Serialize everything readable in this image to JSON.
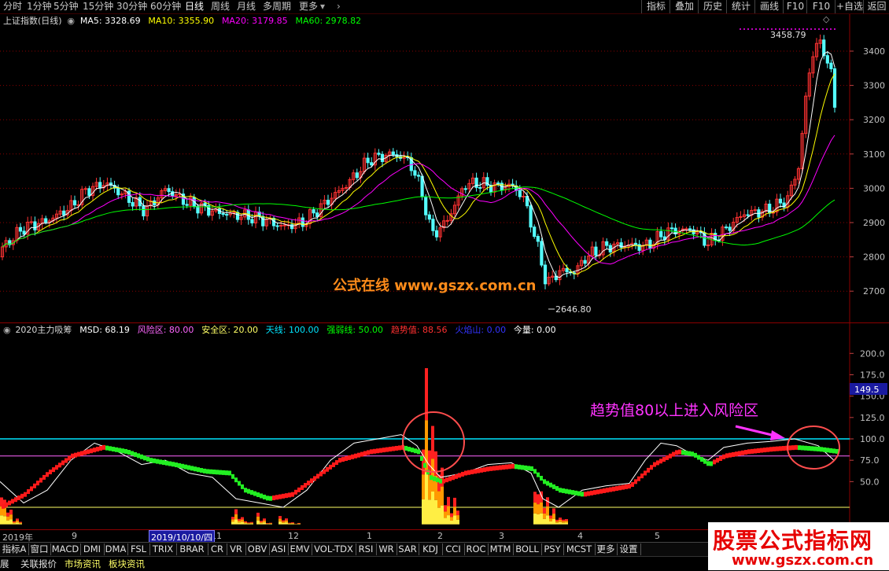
{
  "toolbar": {
    "periods": [
      "分时",
      "1分钟",
      "5分钟",
      "15分钟",
      "30分钟",
      "60分钟",
      "日线",
      "周线",
      "月线",
      "多周期",
      "更多"
    ],
    "active_period": "日线",
    "right_buttons": [
      "指标",
      "叠加",
      "历史",
      "统计",
      "画线",
      "F10",
      "+自选",
      "返回"
    ]
  },
  "main_chart": {
    "index_name": "上证指数(日线)",
    "ma_labels": [
      {
        "text": "MA5: 3328.69",
        "color": "#ffffff"
      },
      {
        "text": "MA10: 3355.90",
        "color": "#ffff00"
      },
      {
        "text": "MA20: 3179.85",
        "color": "#ff00ff"
      },
      {
        "text": "MA60: 2978.82",
        "color": "#00ff00"
      }
    ],
    "price_ticks": [
      "3400",
      "3300",
      "3200",
      "3100",
      "3000",
      "2900",
      "2800",
      "2700"
    ],
    "high_label": "3458.79",
    "low_label": "2646.80",
    "website_text": "公式在线 www.gszx.com.cn"
  },
  "indicator": {
    "name": "2020主力吸筹",
    "params": [
      {
        "text": "MSD: 68.19",
        "color": "#ffffff"
      },
      {
        "text": "风险区: 80.00",
        "color": "#ff66ff"
      },
      {
        "text": "安全区: 20.00",
        "color": "#ffff66"
      },
      {
        "text": "天线: 100.00",
        "color": "#00e5ff"
      },
      {
        "text": "强弱线: 50.00",
        "color": "#00ff00"
      },
      {
        "text": "趋势值: 88.56",
        "color": "#ff3030"
      },
      {
        "text": "火焰山: 0.00",
        "color": "#3333ff"
      },
      {
        "text": "今量: 0.00",
        "color": "#ffffff"
      }
    ],
    "y_ticks": [
      "200.0",
      "175.0",
      "150.0",
      "125.0",
      "100.0",
      "75.0",
      "50.0"
    ],
    "current_value": "149.5",
    "annotation": "趋势值80以上进入风险区"
  },
  "time_axis": {
    "labels": [
      "2019年",
      "9",
      "11",
      "12",
      "1",
      "2",
      "3",
      "4",
      "5"
    ],
    "cursor_date": "2019/10/10/四"
  },
  "indicator_tabs": [
    "指标A",
    "窗口",
    "MACD",
    "DMI",
    "DMA",
    "FSL",
    "TRIX",
    "BRAR",
    "CR",
    "VR",
    "OBV",
    "ASI",
    "EMV",
    "VOL-TDX",
    "RSI",
    "WR",
    "SAR",
    "KDJ",
    "CCI",
    "ROC",
    "MTM",
    "BOLL",
    "PSY",
    "MCST",
    "更多",
    "设置"
  ],
  "status_tabs": [
    "展",
    "关联报价",
    "市场资讯",
    "板块资讯"
  ],
  "watermark": {
    "title": "股票公式指标网",
    "url": "www.gszx.com.cn"
  },
  "colors": {
    "up": "#ff3232",
    "down": "#54ffff",
    "ma5": "#ffffff",
    "ma10": "#ffff00",
    "ma20": "#ff00ff",
    "ma60": "#00ff00",
    "grid": "#8b0000",
    "active_tab": "#ffffff"
  }
}
